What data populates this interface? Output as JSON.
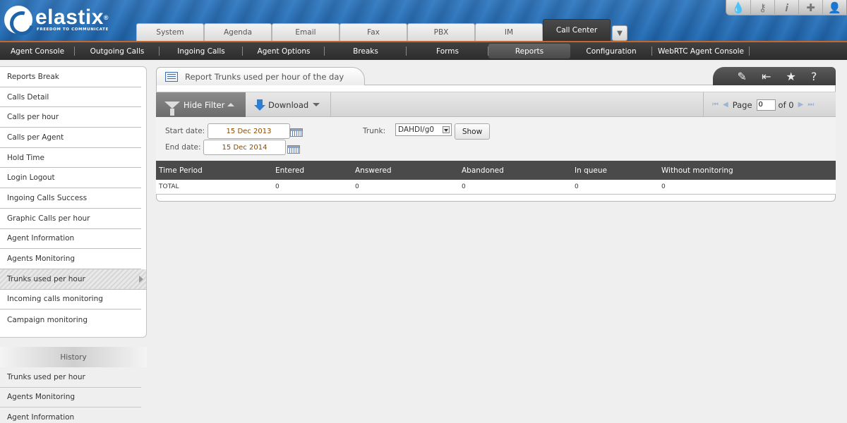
{
  "brand": {
    "name": "elastix",
    "registered": "®",
    "tagline": "FREEDOM TO COMMUNICATE"
  },
  "top_icons": [
    "drop-icon",
    "key-icon",
    "info-icon",
    "puzzle-icon",
    "user-icon"
  ],
  "top_icon_glyphs": [
    "💧",
    "⚷",
    "𝒊",
    "✚",
    "👤"
  ],
  "main_tabs": [
    {
      "label": "System"
    },
    {
      "label": "Agenda"
    },
    {
      "label": "Email"
    },
    {
      "label": "Fax"
    },
    {
      "label": "PBX"
    },
    {
      "label": "IM"
    },
    {
      "label": "Call Center",
      "active": true
    }
  ],
  "subnav": [
    {
      "label": "Agent Console"
    },
    {
      "label": "Outgoing Calls"
    },
    {
      "label": "Ingoing Calls"
    },
    {
      "label": "Agent Options"
    },
    {
      "label": "Breaks"
    },
    {
      "label": "Forms"
    },
    {
      "label": "Reports",
      "active": true
    },
    {
      "label": "Configuration"
    },
    {
      "label": "WebRTC Agent Console"
    }
  ],
  "sidebar": {
    "items": [
      {
        "label": "Reports Break"
      },
      {
        "label": "Calls Detail"
      },
      {
        "label": "Calls per hour"
      },
      {
        "label": "Calls per Agent"
      },
      {
        "label": "Hold Time"
      },
      {
        "label": "Login Logout"
      },
      {
        "label": "Ingoing Calls Success"
      },
      {
        "label": "Graphic Calls per hour"
      },
      {
        "label": "Agent Information"
      },
      {
        "label": "Agents Monitoring"
      },
      {
        "label": "Trunks used per hour",
        "active": true
      },
      {
        "label": "Incoming calls monitoring"
      },
      {
        "label": "Campaign monitoring"
      }
    ]
  },
  "history": {
    "title": "History",
    "items": [
      {
        "label": "Trunks used per hour"
      },
      {
        "label": "Agents Monitoring"
      },
      {
        "label": "Agent Information"
      }
    ]
  },
  "panel": {
    "title": "Report Trunks used per hour of the day",
    "tools": [
      "✎",
      "⇤",
      "★",
      "?"
    ]
  },
  "toolbar": {
    "hide_filter": "Hide Filter",
    "download": "Download",
    "page_label": "Page",
    "page_value": "0",
    "of_label": "of 0"
  },
  "filter": {
    "start_label": "Start date:",
    "start_value": "15 Dec 2013",
    "end_label": "End date:",
    "end_value": "15 Dec 2014",
    "trunk_label": "Trunk:",
    "trunk_value": "DAHDI/g0",
    "show_button": "Show"
  },
  "table": {
    "headers": [
      "Time Period",
      "Entered",
      "Answered",
      "Abandoned",
      "In queue",
      "Without monitoring"
    ],
    "rows": [
      [
        "TOTAL",
        "0",
        "0",
        "0",
        "0",
        "0"
      ]
    ]
  },
  "colors": {
    "accent": "#c8652a",
    "header_blue": "#1d5fa3",
    "nav_dark": "#333333"
  }
}
